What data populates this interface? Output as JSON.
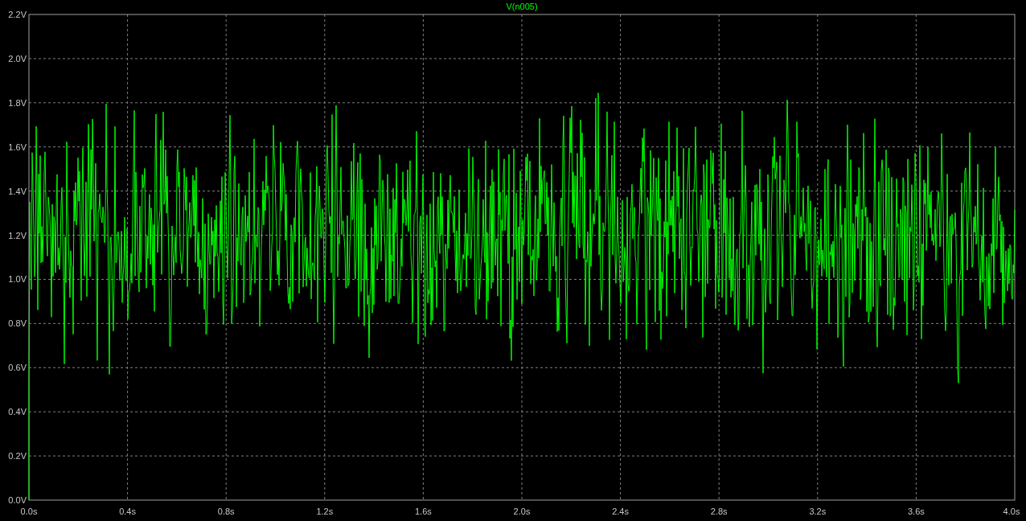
{
  "title": "V(n005)",
  "y_ticks": [
    "2.2V",
    "2.0V",
    "1.8V",
    "1.6V",
    "1.4V",
    "1.2V",
    "1.0V",
    "0.8V",
    "0.6V",
    "0.4V",
    "0.2V",
    "0.0V"
  ],
  "x_ticks": [
    "0.0s",
    "0.4s",
    "0.8s",
    "1.2s",
    "1.6s",
    "2.0s",
    "2.4s",
    "2.8s",
    "3.2s",
    "3.6s",
    "4.0s"
  ]
}
